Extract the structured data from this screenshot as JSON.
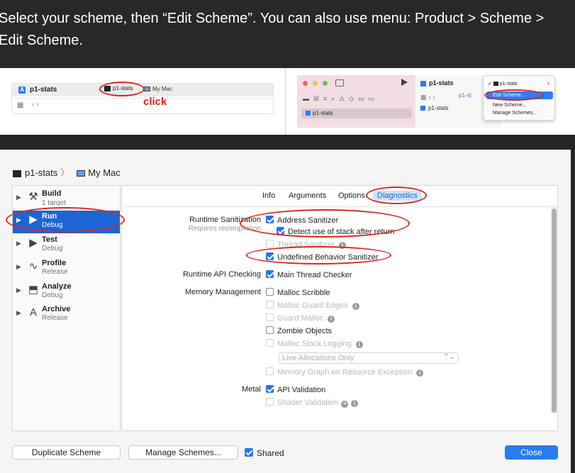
{
  "instruction": {
    "line1": "Select your scheme, then “Edit Scheme”. You can also use menu: Product > Scheme >",
    "line2": "Edit Scheme."
  },
  "left_shot": {
    "project": "p1-stats",
    "scheme": "p1-stats",
    "destination": "My Mac",
    "callout": "click"
  },
  "right_shot": {
    "project": "p1-stats",
    "tab": "p1-st",
    "tree_item": "p1-stats",
    "sub_item": "p1-stats",
    "menu": {
      "current": "p1-stats",
      "items": [
        "Edit Scheme...",
        "New Scheme...",
        "Manage Schemes..."
      ]
    }
  },
  "editor": {
    "breadcrumb": {
      "scheme": "p1-stats",
      "destination": "My Mac"
    },
    "actions": [
      {
        "name": "Build",
        "sub": "1 target",
        "icon": "hammer-icon",
        "glyph": "⚒"
      },
      {
        "name": "Run",
        "sub": "Debug",
        "icon": "play-icon",
        "glyph": "▶"
      },
      {
        "name": "Test",
        "sub": "Debug",
        "icon": "test-icon",
        "glyph": "▶"
      },
      {
        "name": "Profile",
        "sub": "Release",
        "icon": "profile-icon",
        "glyph": "∿"
      },
      {
        "name": "Analyze",
        "sub": "Debug",
        "icon": "analyze-icon",
        "glyph": "⬒"
      },
      {
        "name": "Archive",
        "sub": "Release",
        "icon": "archive-icon",
        "glyph": "A"
      }
    ],
    "selected_action": "Run",
    "tabs": [
      "Info",
      "Arguments",
      "Options",
      "Diagnostics"
    ],
    "active_tab": "Diagnostics",
    "sections": {
      "runtime_sanitization": {
        "label": "Runtime Sanitization",
        "hint": "Requires recompilation",
        "address_sanitizer": {
          "label": "Address Sanitizer",
          "checked": true
        },
        "stack_after_return": {
          "label": "Detect use of stack after return",
          "checked": true
        },
        "thread_sanitizer": {
          "label": "Thread Sanitizer",
          "checked": false,
          "disabled": true
        },
        "undefined_behavior": {
          "label": "Undefined Behavior Sanitizer",
          "checked": true
        }
      },
      "runtime_api": {
        "label": "Runtime API Checking",
        "main_thread_checker": {
          "label": "Main Thread Checker",
          "checked": true
        }
      },
      "memory_management": {
        "label": "Memory Management",
        "malloc_scribble": {
          "label": "Malloc Scribble",
          "checked": false
        },
        "malloc_guard_edges": {
          "label": "Malloc Guard Edges",
          "checked": false,
          "disabled": true
        },
        "guard_malloc": {
          "label": "Guard Malloc",
          "checked": false,
          "disabled": true
        },
        "zombie_objects": {
          "label": "Zombie Objects",
          "checked": false
        },
        "malloc_stack_logging": {
          "label": "Malloc Stack Logging",
          "checked": false,
          "disabled": true
        },
        "logging_select": "Live Allocations Only",
        "memory_graph": {
          "label": "Memory Graph on Resource Exception",
          "checked": false,
          "disabled": true
        }
      },
      "metal": {
        "label": "Metal",
        "api_validation": {
          "label": "API Validation",
          "checked": true
        },
        "shader_validation": {
          "label": "Shader Validation",
          "checked": false,
          "disabled": true
        }
      }
    },
    "buttons": {
      "duplicate": "Duplicate Scheme",
      "manage": "Manage Schemes...",
      "shared": "Shared",
      "close": "Close"
    },
    "colors": {
      "selection": "#1f64d4",
      "accent": "#2a7bf0",
      "annotation": "#d8281b"
    }
  }
}
